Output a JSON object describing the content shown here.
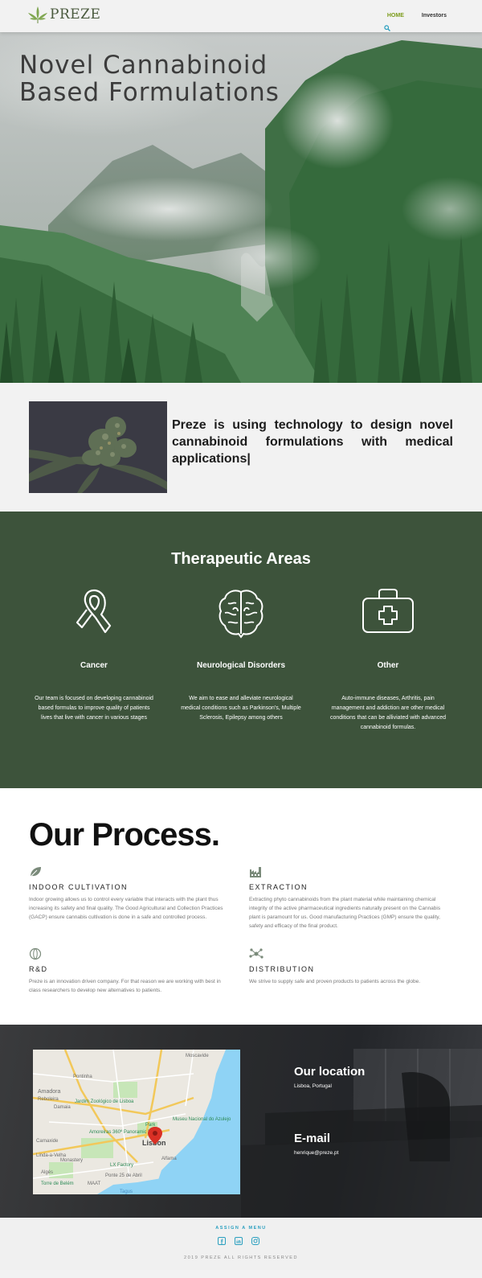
{
  "header": {
    "logo_text": "PREZE",
    "nav": [
      {
        "label": "HOME"
      },
      {
        "label": "Investors"
      }
    ]
  },
  "hero": {
    "title_line1": "Novel Cannabinoid",
    "title_line2": "Based Formulations"
  },
  "intro": {
    "text": "Preze is using technology to design novel cannabinoid formulations with medical applications|"
  },
  "therapeutic": {
    "title": "Therapeutic Areas",
    "areas": [
      {
        "name": "Cancer",
        "icon": "ribbon-icon",
        "desc": "Our team is focused on developing cannabinoid based formulas to improve quality of patients lives that live with cancer in various stages"
      },
      {
        "name": "Neurological Disorders",
        "icon": "brain-icon",
        "desc": "We aim to ease and alleviate neurological medical conditions such as Parkinson's, Multiple Sclerosis, Epilepsy among others"
      },
      {
        "name": "Other",
        "icon": "first-aid-kit-icon",
        "desc": "Auto-immune diseases, Arthritis, pain management and addiction are other medical conditions that can be alliviated with advanced cannabinoid formulas."
      }
    ]
  },
  "process": {
    "title": "Our Process.",
    "items": [
      {
        "name": "INDOOR CULTIVATION",
        "icon": "leaf-icon",
        "desc": "Indoor growing allows us to control every variable that interacts with the plant thus increasing its safety and final quality. The Good Agricultural and Collection Practices (GACP) ensure cannabis cultivation is done in a safe and controlled process."
      },
      {
        "name": "EXTRACTION",
        "icon": "factory-icon",
        "desc": "Extracting phyto cannabinoids from the plant material while maintaining chemical integrity of the active pharmaceutical ingredients naturally present on the Cannabis plant is paramount for us. Good manufacturing Practices (GMP) ensure the quality, safety and efficacy of the final product."
      },
      {
        "name": "R&D",
        "icon": "globe-icon",
        "desc": "Preze is an innovation driven company. For that reason we are working with best in class researchers to develop new alternatives to patients."
      },
      {
        "name": "DISTRIBUTION",
        "icon": "network-icon",
        "desc": "We strive to supply safe and proven products to patients across the globe."
      }
    ]
  },
  "location": {
    "title": "Our location",
    "address": "Lisboa, Portugal",
    "email_title": "E-mail",
    "email": "henrique@preze.pt",
    "map_labels": {
      "city": "Lisbon",
      "moscavide": "Moscavide",
      "amadora": "Amadora",
      "reboleira": "Reboleira",
      "pontinha": "Pontinha",
      "damaia": "Damaia",
      "zoo": "Jardim Zoológico de Lisboa",
      "amoreiras": "Amoreiras 360º Panoramic View",
      "carnaxide": "Carnaxide",
      "linda": "Linda-a-Velha",
      "monastery": "Monastery",
      "alges": "Algés",
      "belem": "Torre de Belém",
      "lxfactory": "LX Factory",
      "ponte": "Ponte 25 de Abril",
      "alfama": "Alfama",
      "museu": "Museu Nacional do Azulejo",
      "park": "Park",
      "maat": "MAAT",
      "tagus": "Tagus"
    }
  },
  "footer": {
    "menu": "ASSIGN A MENU",
    "social": [
      "facebook-icon",
      "linkedin-icon",
      "instagram-icon"
    ],
    "copyright": "2019 PREZE ALL RIGHTS RESERVED"
  },
  "colors": {
    "accent": "#7a9a18",
    "dark_green": "#3d533b",
    "link_blue": "#2a9fbf"
  }
}
